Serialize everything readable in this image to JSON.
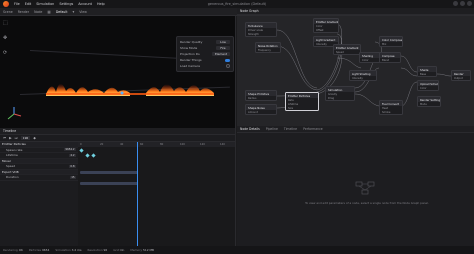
{
  "menu": [
    "File",
    "Edit",
    "Simulation",
    "Settings",
    "Account",
    "Help"
  ],
  "window_title": "generous_fire_simulation (Default)",
  "toolbar": {
    "items": [
      "Scene",
      "Render",
      "Node"
    ],
    "active_label": "Default",
    "view_label": "View"
  },
  "viewport_tabs": [
    "Viewport"
  ],
  "render_settings": [
    {
      "label": "Render Quality",
      "value": "Low",
      "kind": "value"
    },
    {
      "label": "Show Mode",
      "value": "Fire",
      "kind": "value"
    },
    {
      "label": "Projection Ds",
      "value": "Element",
      "kind": "value"
    },
    {
      "label": "Render Things",
      "value": "",
      "kind": "toggle-on"
    },
    {
      "label": "Load Camera",
      "value": "",
      "kind": "radio"
    }
  ],
  "node_graph": {
    "tab": "Node Graph",
    "nodes": [
      {
        "title": "Turbulence",
        "ports": [
          "Driver scale",
          "Strength"
        ]
      },
      {
        "title": "Noise Rotation",
        "ports": [
          "Frequency"
        ]
      },
      {
        "title": "Emitter Gradient",
        "ports": [
          "Color",
          "Offset"
        ]
      },
      {
        "title": "Light Gradient",
        "ports": [
          "Intensity"
        ]
      },
      {
        "title": "Emitter Gradient",
        "ports": [
          "Speed"
        ]
      },
      {
        "title": "Shape Primitive",
        "ports": [
          "Radius"
        ]
      },
      {
        "title": "Shape Noise",
        "ports": [
          "Amount"
        ]
      },
      {
        "title": "Emitter Particles",
        "ports": [
          "Rate",
          "Lifetime",
          "Size"
        ]
      },
      {
        "title": "Simulation",
        "ports": [
          "Gravity",
          "Drag"
        ]
      },
      {
        "title": "Shading",
        "ports": [
          "Color"
        ]
      },
      {
        "title": "Light Shading",
        "ports": [
          "Intensity"
        ]
      },
      {
        "title": "Compose",
        "ports": [
          "Blend"
        ]
      },
      {
        "title": "Fuel Convert",
        "ports": [
          "Heat",
          "Smoke"
        ]
      },
      {
        "title": "Shade",
        "ports": [
          "Base"
        ]
      },
      {
        "title": "Render",
        "ports": [
          "Output"
        ]
      },
      {
        "title": "Upload Scheme",
        "ports": [
          "Color"
        ]
      },
      {
        "title": "Render Settings",
        "ports": [
          "Mode"
        ]
      },
      {
        "title": "Color Compose",
        "ports": [
          "Mix"
        ]
      }
    ]
  },
  "timeline": {
    "tab": "Timeline",
    "frame": "196",
    "rows": [
      {
        "label": "Emitter Particles",
        "value": "",
        "group": true
      },
      {
        "label": "Spawn rate",
        "value": "9654.2",
        "group": false
      },
      {
        "label": "Lifetime",
        "value": "4.2",
        "group": false
      },
      {
        "label": "Mover",
        "value": "",
        "group": true
      },
      {
        "label": "Speed",
        "value": "0.8",
        "group": false
      },
      {
        "label": "Export VDB",
        "value": "",
        "group": true
      },
      {
        "label": "Duration",
        "value": "15",
        "group": false
      }
    ],
    "ruler": [
      "0",
      "20",
      "40",
      "60",
      "80",
      "100",
      "120",
      "140"
    ]
  },
  "bottom_tabs": [
    "Node Details",
    "Pipeline",
    "Timeline",
    "Performance"
  ],
  "empty_message": "To view and edit parameters of a node, select a single node from the Node Graph panel.",
  "status": [
    {
      "label": "Rendering",
      "value": "OK"
    },
    {
      "label": "Particles",
      "value": "9654"
    },
    {
      "label": "Simulation",
      "value": "3.2 ms"
    },
    {
      "label": "Resolution",
      "value": "96"
    },
    {
      "label": "Grid",
      "value": "On"
    },
    {
      "label": "Memory",
      "value": "512 MB"
    }
  ],
  "colors": {
    "accent": "#2f7fe0",
    "playhead": "#3a8ef0",
    "fire": "#ff6a1a"
  }
}
